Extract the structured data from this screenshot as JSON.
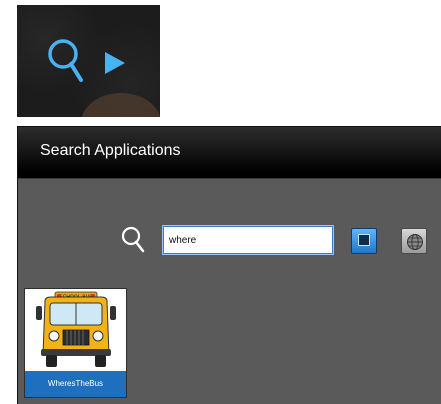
{
  "panel": {
    "title": "Search Applications"
  },
  "search": {
    "value": "where",
    "placeholder": ""
  },
  "icons": {
    "thumb_magnifier": "magnifier-icon",
    "thumb_play": "play-icon",
    "search": "search-icon",
    "device": "device-icon",
    "web": "globe-icon"
  },
  "results": [
    {
      "name": "WheresTheBus",
      "icon": "school-bus-icon"
    }
  ],
  "colors": {
    "panel_bg": "#5a5a5a",
    "header_bg": "#000000",
    "accent_blue": "#1f6fbf",
    "icon_blue": "#49b2f0"
  }
}
